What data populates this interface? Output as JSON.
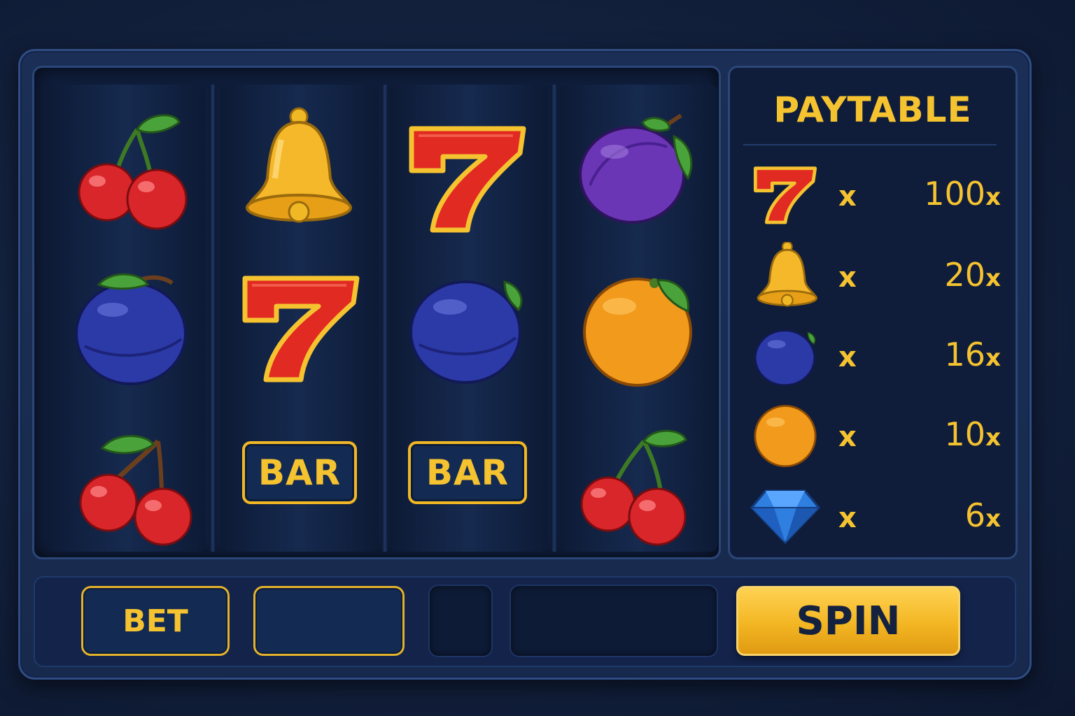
{
  "reels": [
    [
      "cherry-icon",
      "plum-blue-icon",
      "cherry-icon"
    ],
    [
      "bell-icon",
      "seven-icon",
      "bar-icon"
    ],
    [
      "seven-icon",
      "plum-blue-icon",
      "bar-icon"
    ],
    [
      "plum-purple-icon",
      "orange-icon",
      "cherry-icon"
    ]
  ],
  "bar_label": "BAR",
  "seven_glyph": "7",
  "paytable": {
    "title": "PAYTABLE",
    "multiplier_symbol": "x",
    "rows": [
      {
        "icon": "seven-icon",
        "value": "100",
        "suffix": "x"
      },
      {
        "icon": "bell-icon",
        "value": "20",
        "suffix": "x"
      },
      {
        "icon": "plum-blue-icon",
        "value": "16",
        "suffix": "x"
      },
      {
        "icon": "orange-icon",
        "value": "10",
        "suffix": "x"
      },
      {
        "icon": "diamond-icon",
        "value": "6",
        "suffix": "x"
      }
    ]
  },
  "controls": {
    "bet_label": "BET",
    "bet_value": "",
    "spin_label": "SPIN"
  },
  "colors": {
    "gold": "#f5c230",
    "panel": "#0f1d3a",
    "frame": "#1b2f56",
    "cherry_red": "#d9262b",
    "plum_blue": "#2c3aa8",
    "plum_purple": "#6a36b5",
    "orange": "#f29a1c",
    "seven_red": "#e02a22"
  }
}
